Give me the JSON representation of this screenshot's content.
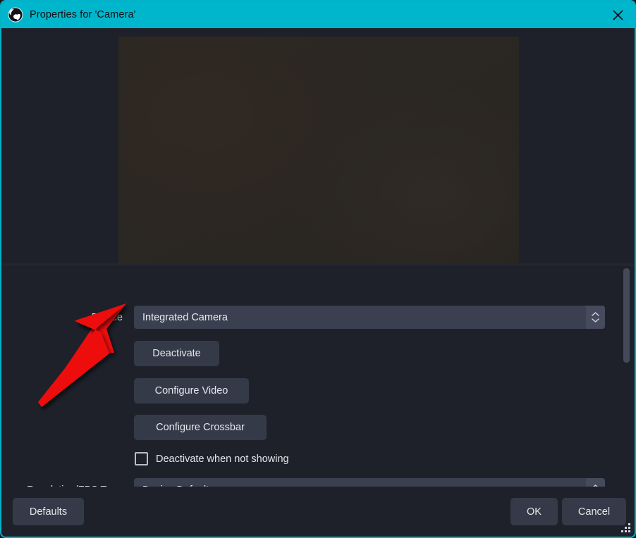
{
  "window": {
    "title": "Properties for 'Camera'",
    "app_icon": "obs-logo-icon",
    "close_icon": "close-icon",
    "titlebar_color": "#00b6cc",
    "border_color": "#00b3c8",
    "background_color": "#1e212a"
  },
  "preview": {
    "name": "camera-video-preview",
    "description": "dark camera feed"
  },
  "form": {
    "device": {
      "label": "Device",
      "value": "Integrated Camera",
      "spinner_icon": "chevron-up-down-icon"
    },
    "deactivate_button": "Deactivate",
    "configure_video_button": "Configure Video",
    "configure_crossbar_button": "Configure Crossbar",
    "deactivate_when_not_showing": {
      "label": "Deactivate when not showing",
      "checked": false
    },
    "resolution_fps_type": {
      "label": "Resolution/FPS Type",
      "value": "Device Default",
      "spinner_icon": "chevron-up-down-icon"
    }
  },
  "footer": {
    "defaults_label": "Defaults",
    "ok_label": "OK",
    "cancel_label": "Cancel",
    "resize_grip_icon": "resize-grip-icon"
  },
  "annotation": {
    "arrow_color": "#ee1111",
    "name": "red-pointer-arrow",
    "points_to": "device-combobox"
  },
  "scrollbar": {
    "name": "vertical-scrollbar",
    "thumb_color": "#434959"
  }
}
